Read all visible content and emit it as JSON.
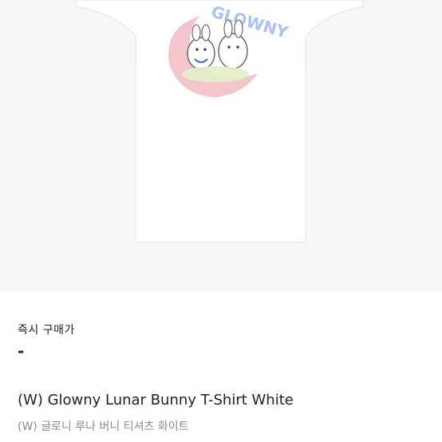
{
  "product": {
    "image_alt": "white t-shirt with bunny graphic",
    "print_text": "GLOWNY",
    "purchase_label": "즉시 구매가",
    "price": "-",
    "title_en": "(W) Glowny Lunar Bunny T-Shirt White",
    "title_ko": "(W) 글로니 루나 버니 티셔츠 화이트"
  },
  "colors": {
    "background_top": "#f7f7f7",
    "shirt": "#ffffff",
    "text_primary": "#222222",
    "text_secondary": "#8c8c8c",
    "moon_pink": "#f2c0c8",
    "print_blue": "#a9c3f3"
  }
}
